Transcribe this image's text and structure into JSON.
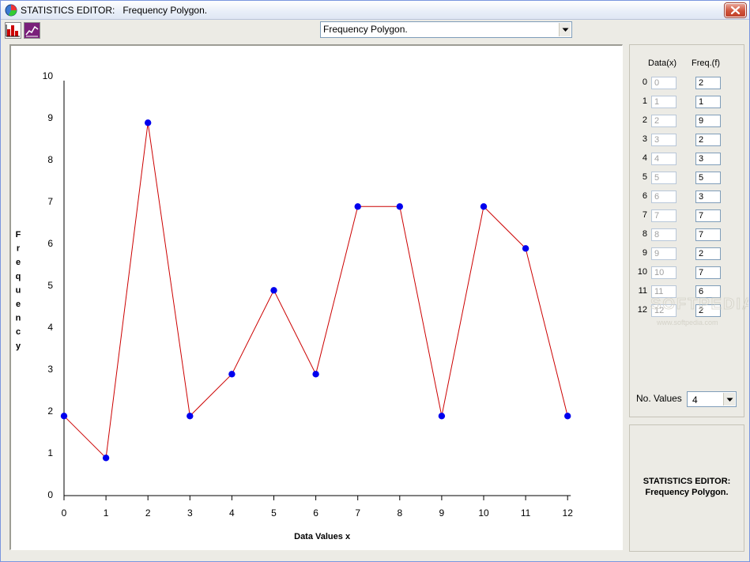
{
  "window": {
    "title": "STATISTICS EDITOR:   Frequency Polygon."
  },
  "toolbar": {
    "buttons": [
      {
        "icon": "bar-chart-icon"
      },
      {
        "icon": "line-chart-icon"
      }
    ],
    "chart_type_select": {
      "value": "Frequency Polygon."
    }
  },
  "table": {
    "header_x": "Data(x)",
    "header_f": "Freq.(f)",
    "rows": [
      {
        "index": "0",
        "x": "0",
        "f": "2"
      },
      {
        "index": "1",
        "x": "1",
        "f": "1"
      },
      {
        "index": "2",
        "x": "2",
        "f": "9"
      },
      {
        "index": "3",
        "x": "3",
        "f": "2"
      },
      {
        "index": "4",
        "x": "4",
        "f": "3"
      },
      {
        "index": "5",
        "x": "5",
        "f": "5"
      },
      {
        "index": "6",
        "x": "6",
        "f": "3"
      },
      {
        "index": "7",
        "x": "7",
        "f": "7"
      },
      {
        "index": "8",
        "x": "8",
        "f": "7"
      },
      {
        "index": "9",
        "x": "9",
        "f": "2"
      },
      {
        "index": "10",
        "x": "10",
        "f": "7"
      },
      {
        "index": "11",
        "x": "11",
        "f": "6"
      },
      {
        "index": "12",
        "x": "12",
        "f": "2"
      }
    ]
  },
  "no_values": {
    "label": "No. Values",
    "value": "4"
  },
  "watermark": {
    "line1": "SOFTPEDIA",
    "line2": "www.softpedia.com"
  },
  "info": {
    "line1": "STATISTICS EDITOR:",
    "line2": "Frequency Polygon."
  },
  "colors": {
    "line": "#cc0000",
    "point": "#0000ee"
  },
  "chart_data": {
    "type": "line",
    "x": [
      0,
      1,
      2,
      3,
      4,
      5,
      6,
      7,
      8,
      9,
      10,
      11,
      12
    ],
    "values": [
      1.9,
      0.9,
      8.9,
      1.9,
      2.9,
      4.9,
      2.9,
      6.9,
      6.9,
      1.9,
      6.9,
      5.9,
      1.9
    ],
    "xlabel": "Data Values x",
    "ylabel": "Frequency",
    "xlim": [
      0,
      12
    ],
    "ylim": [
      0,
      10
    ],
    "x_ticks": [
      "0",
      "1",
      "2",
      "3",
      "4",
      "5",
      "6",
      "7",
      "8",
      "9",
      "10",
      "11",
      "12"
    ],
    "y_ticks": [
      "0",
      "1",
      "2",
      "3",
      "4",
      "5",
      "6",
      "7",
      "8",
      "9",
      "10"
    ],
    "grid": false,
    "markers": true
  }
}
